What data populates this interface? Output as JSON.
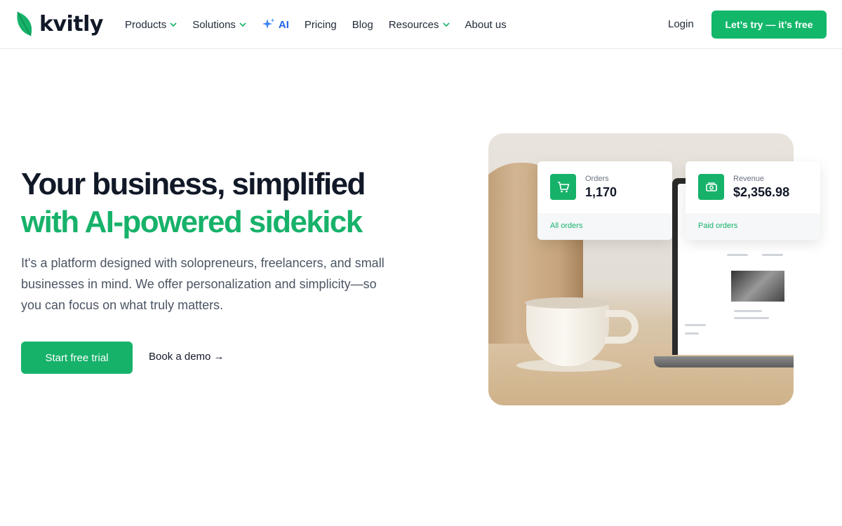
{
  "brand": {
    "name": "kvitly",
    "accent": "#17b26a"
  },
  "nav": {
    "items": [
      {
        "label": "Products",
        "has_menu": true
      },
      {
        "label": "Solutions",
        "has_menu": true
      },
      {
        "label": "AI",
        "has_menu": false
      },
      {
        "label": "Pricing",
        "has_menu": false
      },
      {
        "label": "Blog",
        "has_menu": false
      },
      {
        "label": "Resources",
        "has_menu": true
      },
      {
        "label": "About us",
        "has_menu": false
      }
    ],
    "login": "Login",
    "cta": "Let’s try — it’s free"
  },
  "hero": {
    "title_line1": "Your business, simplified",
    "title_line2": "with AI-powered sidekick",
    "description": "It's a platform designed with solopreneurs, freelancers, and small businesses in mind. We offer personalization and simplicity—so you can focus on what truly matters.",
    "primary_button": "Start free trial",
    "secondary_link": "Book a demo →"
  },
  "stats": {
    "orders": {
      "label": "Orders",
      "value": "1,170",
      "link": "All orders",
      "icon": "cart-icon"
    },
    "revenue": {
      "label": "Revenue",
      "value": "$2,356.98",
      "link": "Paid orders",
      "icon": "cash-icon"
    }
  }
}
